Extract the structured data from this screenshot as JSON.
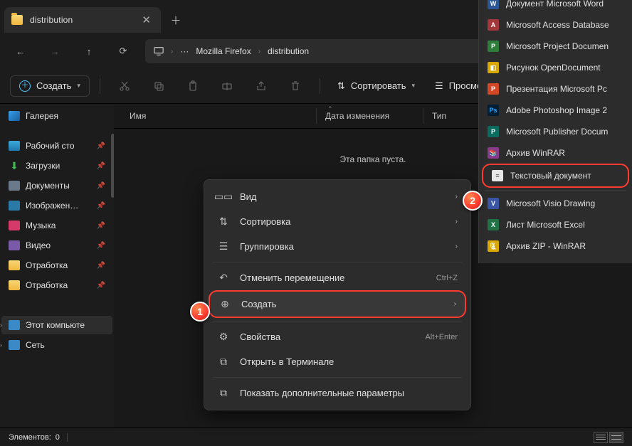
{
  "tab": {
    "title": "distribution"
  },
  "addr": {
    "crumb1": "Mozilla Firefox",
    "crumb2": "distribution",
    "dots": "···"
  },
  "toolbar": {
    "new": "Создать",
    "sort": "Сортировать",
    "view": "Просмотрет"
  },
  "sidebar": {
    "gallery": "Галерея",
    "desktop": "Рабочий сто",
    "downloads": "Загрузки",
    "documents": "Документы",
    "pictures": "Изображен…",
    "music": "Музыка",
    "videos": "Видео",
    "work1": "Отработка",
    "work2": "Отработка",
    "thispc": "Этот компьюте",
    "network": "Сеть"
  },
  "headers": {
    "name": "Имя",
    "date": "Дата изменения",
    "type": "Тип"
  },
  "empty": "Эта папка пуста.",
  "ctx": {
    "view": "Вид",
    "sort": "Сортировка",
    "group": "Группировка",
    "undo": "Отменить перемещение",
    "undo_sc": "Ctrl+Z",
    "new": "Создать",
    "props": "Свойства",
    "props_sc": "Alt+Enter",
    "terminal": "Открыть в Терминале",
    "more": "Показать дополнительные параметры"
  },
  "sub": {
    "word": "Документ Microsoft Word",
    "access": "Microsoft Access Database",
    "project": "Microsoft Project Documen",
    "odg": "Рисунок OpenDocument",
    "ppt": "Презентация Microsoft Pс",
    "psd": "Adobe Photoshop Image 2",
    "pub": "Microsoft Publisher Docum",
    "rar": "Архив WinRAR",
    "txt": "Текстовый документ",
    "visio": "Microsoft Visio Drawing",
    "xls": "Лист Microsoft Excel",
    "zip": "Архив ZIP - WinRAR"
  },
  "status": {
    "items_label": "Элементов:",
    "items_count": "0"
  },
  "badges": {
    "b1": "1",
    "b2": "2"
  }
}
